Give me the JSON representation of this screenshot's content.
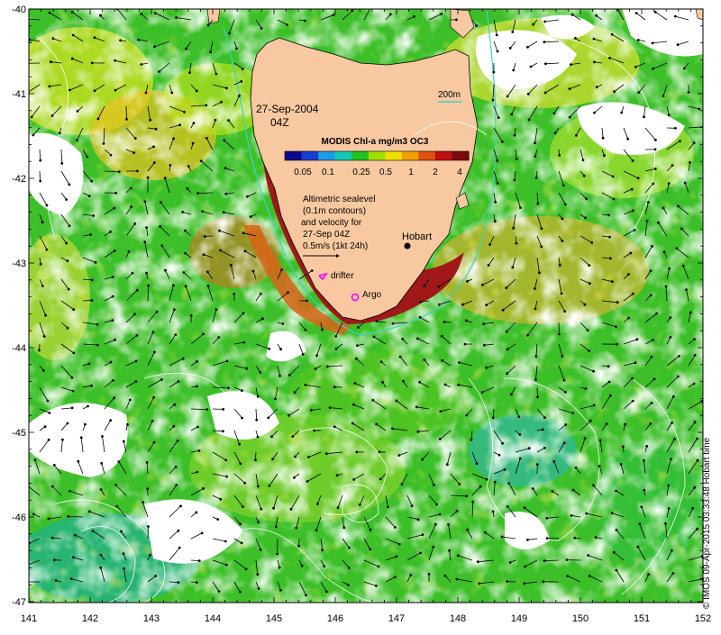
{
  "map": {
    "date_line1": "27-Sep-2004",
    "date_line2": "04Z",
    "legend_title": "MODIS Chl-a mg/m3 OC3",
    "legend_ticks": [
      "0.05",
      "0.1",
      "0.25",
      "0.5",
      "1",
      "2",
      "4"
    ],
    "legend_colors": [
      "#0a0a8c",
      "#1a3cd0",
      "#1e9be8",
      "#14c8b4",
      "#20c020",
      "#a0e000",
      "#f0e000",
      "#f0a000",
      "#e05010",
      "#c01010",
      "#7a0a0a"
    ],
    "isobath_label": "200m",
    "isobath_color": "#3cd2c8",
    "altimetry_note": [
      "Altimetric sealevel",
      "(0.1m contours)",
      "and velocity for",
      "27-Sep 04Z",
      "0.5m/s (1kt 24h)"
    ],
    "city_label": "Hobart",
    "drifter_label": "drifter",
    "argo_label": "Argo",
    "marker_color": "#ff00ff",
    "land_color": "#f8c8a0",
    "x_ticks": [
      "141",
      "142",
      "143",
      "144",
      "145",
      "146",
      "147",
      "148",
      "149",
      "150",
      "151",
      "152"
    ],
    "y_ticks": [
      "-40",
      "-41",
      "-42",
      "-43",
      "-44",
      "-45",
      "-46",
      "-47"
    ],
    "credit": "© IMOS 09-Apr-2015 03:33:48 Hobart time"
  }
}
